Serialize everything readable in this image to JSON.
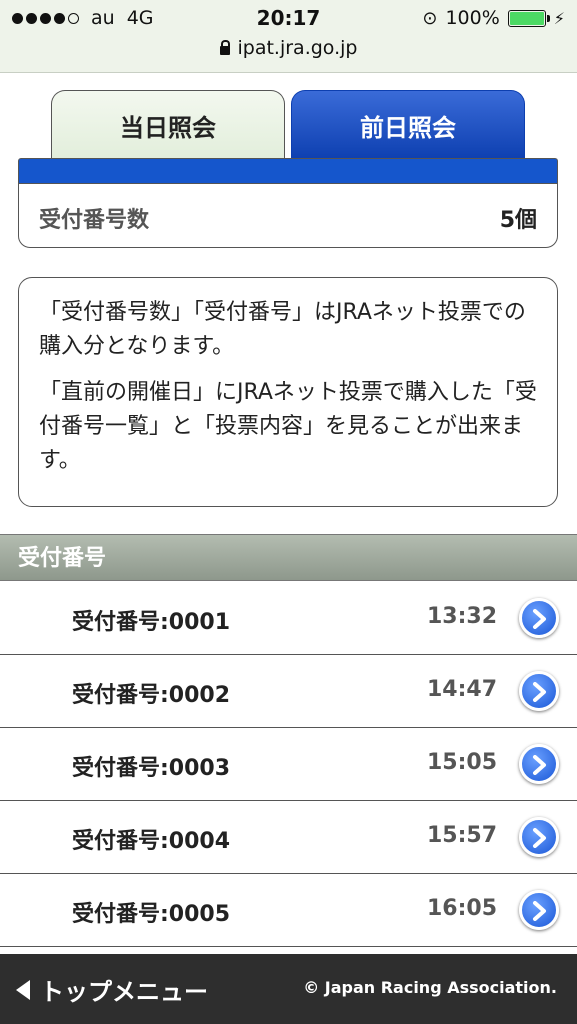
{
  "status_bar": {
    "carrier": "au",
    "network": "4G",
    "time": "20:17",
    "battery": "100%",
    "url": "ipat.jra.go.jp"
  },
  "tabs": [
    {
      "label": "当日照会",
      "active": false
    },
    {
      "label": "前日照会",
      "active": true
    }
  ],
  "summary": {
    "label": "受付番号数",
    "value": "5個"
  },
  "info": {
    "paragraph1": "「受付番号数」「受付番号」はJRAネット投票での購入分となります。",
    "paragraph2": "「直前の開催日」にJRAネット投票で購入した「受付番号一覧」と「投票内容」を見ることが出来ます。"
  },
  "section": {
    "title": "受付番号"
  },
  "receipts": [
    {
      "label": "受付番号:0001",
      "time": "13:32"
    },
    {
      "label": "受付番号:0002",
      "time": "14:47"
    },
    {
      "label": "受付番号:0003",
      "time": "15:05"
    },
    {
      "label": "受付番号:0004",
      "time": "15:57"
    },
    {
      "label": "受付番号:0005",
      "time": "16:05"
    }
  ],
  "footer": {
    "menu_label": "トップメニュー",
    "copyright": "© Japan Racing Association."
  },
  "colors": {
    "accent_blue": "#1556cc",
    "battery_green": "#4cd964",
    "footer_bg": "#2e2e2e"
  }
}
